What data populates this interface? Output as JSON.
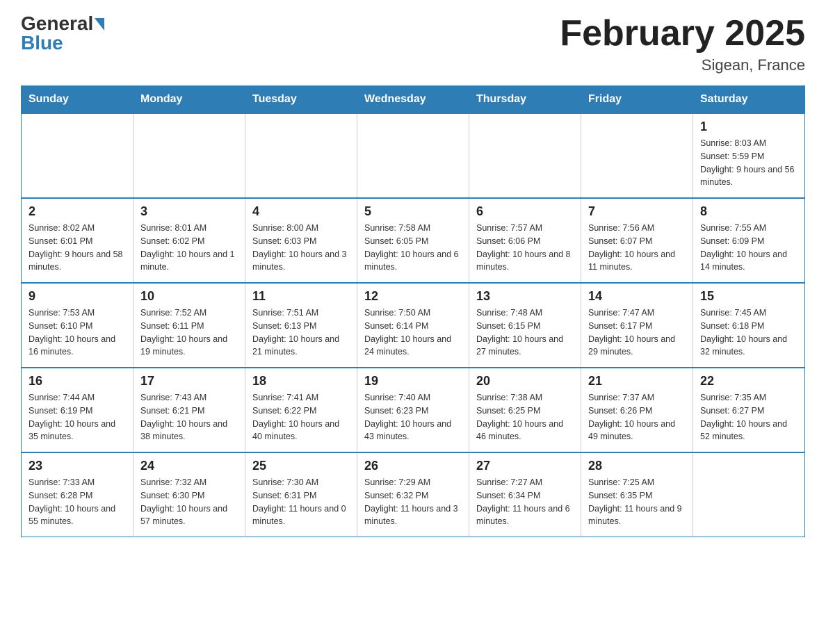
{
  "header": {
    "logo_general": "General",
    "logo_blue": "Blue",
    "month_title": "February 2025",
    "location": "Sigean, France"
  },
  "days_of_week": [
    "Sunday",
    "Monday",
    "Tuesday",
    "Wednesday",
    "Thursday",
    "Friday",
    "Saturday"
  ],
  "weeks": [
    [
      {
        "day": "",
        "info": ""
      },
      {
        "day": "",
        "info": ""
      },
      {
        "day": "",
        "info": ""
      },
      {
        "day": "",
        "info": ""
      },
      {
        "day": "",
        "info": ""
      },
      {
        "day": "",
        "info": ""
      },
      {
        "day": "1",
        "info": "Sunrise: 8:03 AM\nSunset: 5:59 PM\nDaylight: 9 hours and 56 minutes."
      }
    ],
    [
      {
        "day": "2",
        "info": "Sunrise: 8:02 AM\nSunset: 6:01 PM\nDaylight: 9 hours and 58 minutes."
      },
      {
        "day": "3",
        "info": "Sunrise: 8:01 AM\nSunset: 6:02 PM\nDaylight: 10 hours and 1 minute."
      },
      {
        "day": "4",
        "info": "Sunrise: 8:00 AM\nSunset: 6:03 PM\nDaylight: 10 hours and 3 minutes."
      },
      {
        "day": "5",
        "info": "Sunrise: 7:58 AM\nSunset: 6:05 PM\nDaylight: 10 hours and 6 minutes."
      },
      {
        "day": "6",
        "info": "Sunrise: 7:57 AM\nSunset: 6:06 PM\nDaylight: 10 hours and 8 minutes."
      },
      {
        "day": "7",
        "info": "Sunrise: 7:56 AM\nSunset: 6:07 PM\nDaylight: 10 hours and 11 minutes."
      },
      {
        "day": "8",
        "info": "Sunrise: 7:55 AM\nSunset: 6:09 PM\nDaylight: 10 hours and 14 minutes."
      }
    ],
    [
      {
        "day": "9",
        "info": "Sunrise: 7:53 AM\nSunset: 6:10 PM\nDaylight: 10 hours and 16 minutes."
      },
      {
        "day": "10",
        "info": "Sunrise: 7:52 AM\nSunset: 6:11 PM\nDaylight: 10 hours and 19 minutes."
      },
      {
        "day": "11",
        "info": "Sunrise: 7:51 AM\nSunset: 6:13 PM\nDaylight: 10 hours and 21 minutes."
      },
      {
        "day": "12",
        "info": "Sunrise: 7:50 AM\nSunset: 6:14 PM\nDaylight: 10 hours and 24 minutes."
      },
      {
        "day": "13",
        "info": "Sunrise: 7:48 AM\nSunset: 6:15 PM\nDaylight: 10 hours and 27 minutes."
      },
      {
        "day": "14",
        "info": "Sunrise: 7:47 AM\nSunset: 6:17 PM\nDaylight: 10 hours and 29 minutes."
      },
      {
        "day": "15",
        "info": "Sunrise: 7:45 AM\nSunset: 6:18 PM\nDaylight: 10 hours and 32 minutes."
      }
    ],
    [
      {
        "day": "16",
        "info": "Sunrise: 7:44 AM\nSunset: 6:19 PM\nDaylight: 10 hours and 35 minutes."
      },
      {
        "day": "17",
        "info": "Sunrise: 7:43 AM\nSunset: 6:21 PM\nDaylight: 10 hours and 38 minutes."
      },
      {
        "day": "18",
        "info": "Sunrise: 7:41 AM\nSunset: 6:22 PM\nDaylight: 10 hours and 40 minutes."
      },
      {
        "day": "19",
        "info": "Sunrise: 7:40 AM\nSunset: 6:23 PM\nDaylight: 10 hours and 43 minutes."
      },
      {
        "day": "20",
        "info": "Sunrise: 7:38 AM\nSunset: 6:25 PM\nDaylight: 10 hours and 46 minutes."
      },
      {
        "day": "21",
        "info": "Sunrise: 7:37 AM\nSunset: 6:26 PM\nDaylight: 10 hours and 49 minutes."
      },
      {
        "day": "22",
        "info": "Sunrise: 7:35 AM\nSunset: 6:27 PM\nDaylight: 10 hours and 52 minutes."
      }
    ],
    [
      {
        "day": "23",
        "info": "Sunrise: 7:33 AM\nSunset: 6:28 PM\nDaylight: 10 hours and 55 minutes."
      },
      {
        "day": "24",
        "info": "Sunrise: 7:32 AM\nSunset: 6:30 PM\nDaylight: 10 hours and 57 minutes."
      },
      {
        "day": "25",
        "info": "Sunrise: 7:30 AM\nSunset: 6:31 PM\nDaylight: 11 hours and 0 minutes."
      },
      {
        "day": "26",
        "info": "Sunrise: 7:29 AM\nSunset: 6:32 PM\nDaylight: 11 hours and 3 minutes."
      },
      {
        "day": "27",
        "info": "Sunrise: 7:27 AM\nSunset: 6:34 PM\nDaylight: 11 hours and 6 minutes."
      },
      {
        "day": "28",
        "info": "Sunrise: 7:25 AM\nSunset: 6:35 PM\nDaylight: 11 hours and 9 minutes."
      },
      {
        "day": "",
        "info": ""
      }
    ]
  ]
}
